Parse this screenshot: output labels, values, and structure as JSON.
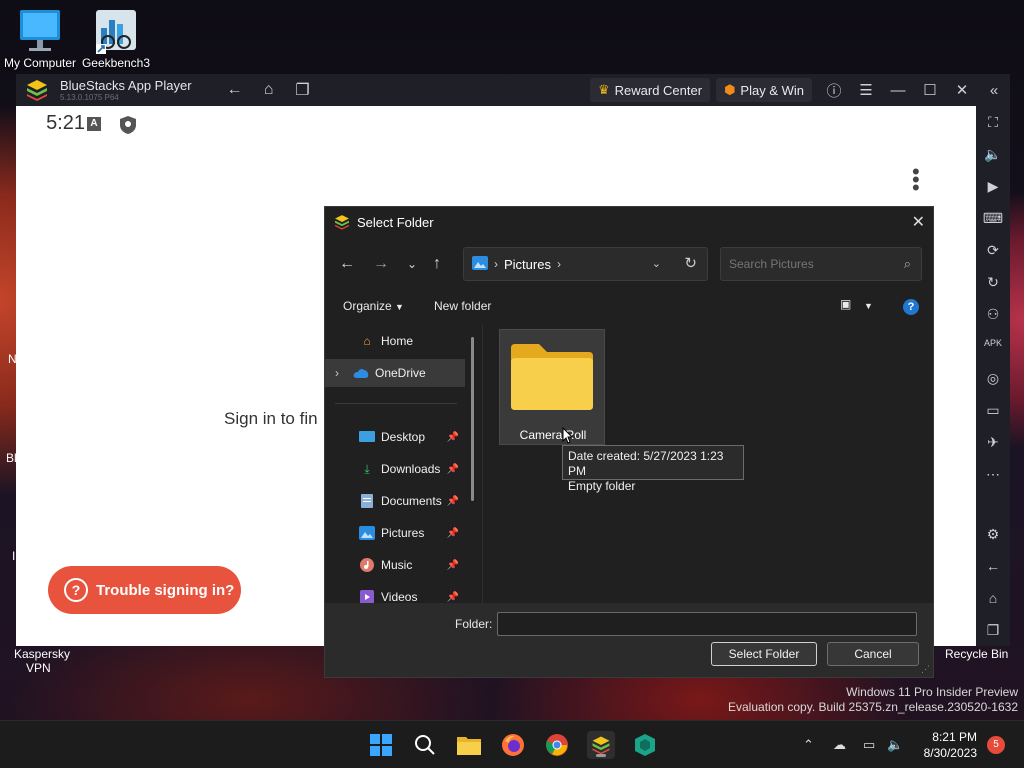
{
  "desktop": {
    "icons": [
      {
        "label": "My Computer",
        "icon": "monitor-icon"
      },
      {
        "label": "Geekbench3",
        "icon": "geekbench-icon"
      }
    ],
    "fragments": {
      "left1": "N",
      "left2": "Bl",
      "left3": "I"
    },
    "kaspersky_line1": "Kaspersky",
    "kaspersky_line2": "VPN",
    "recycle_bin": "Recycle Bin",
    "watermark_line1": "Windows 11 Pro Insider Preview",
    "watermark_line2": "Evaluation copy. Build 25375.zn_release.230520-1632"
  },
  "bluestacks": {
    "title": "BlueStacks App Player",
    "version": "5.13.0.1075 P64",
    "reward_center": "Reward Center",
    "play_win": "Play & Win"
  },
  "android": {
    "time": "5:21",
    "signin_text": "Sign in to fin",
    "trouble_button": "Trouble signing in?"
  },
  "dialog": {
    "title": "Select Folder",
    "address": "Pictures",
    "search_placeholder": "Search Pictures",
    "organize": "Organize",
    "new_folder": "New folder",
    "nav": [
      {
        "label": "Home",
        "icon": "home-icon"
      },
      {
        "label": "OneDrive",
        "icon": "cloud-icon"
      },
      {
        "label": "Desktop",
        "icon": "desktop-icon"
      },
      {
        "label": "Downloads",
        "icon": "download-icon"
      },
      {
        "label": "Documents",
        "icon": "document-icon"
      },
      {
        "label": "Pictures",
        "icon": "picture-icon"
      },
      {
        "label": "Music",
        "icon": "music-icon"
      },
      {
        "label": "Videos",
        "icon": "video-icon"
      }
    ],
    "folder_item": "Camera Roll",
    "tooltip_line1": "Date created: 5/27/2023 1:23 PM",
    "tooltip_line2": "Empty folder",
    "folder_label": "Folder:",
    "folder_value": "",
    "select_button": "Select Folder",
    "cancel_button": "Cancel"
  },
  "taskbar": {
    "time": "8:21 PM",
    "date": "8/30/2023",
    "notifications": "5"
  },
  "colors": {
    "accent": "#1f77d0",
    "trouble_button": "#e8533e",
    "folder_yellow": "#f3c73c"
  }
}
